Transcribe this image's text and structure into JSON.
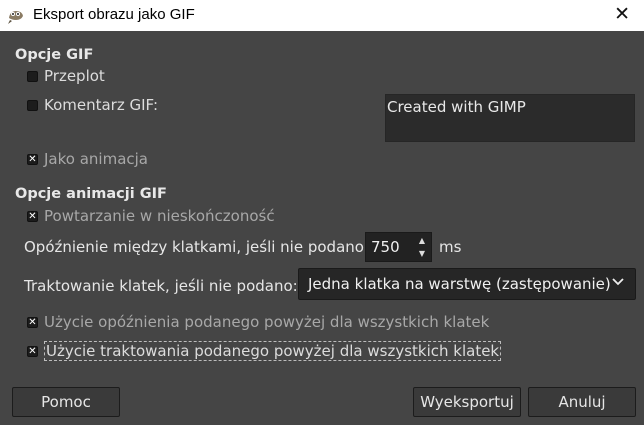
{
  "window": {
    "title": "Eksport obrazu jako GIF",
    "close_glyph": "✕"
  },
  "gif_options": {
    "heading": "Opcje GIF",
    "interlace": {
      "label": "Przeplot",
      "checked": false
    },
    "comment": {
      "label": "Komentarz GIF:",
      "checked": false,
      "value": "Created with GIMP"
    },
    "as_animation": {
      "label": "Jako animacja",
      "checked": true
    }
  },
  "animation_options": {
    "heading": "Opcje animacji GIF",
    "loop_forever": {
      "label": "Powtarzanie w nieskończoność",
      "checked": true
    },
    "delay": {
      "label": "Opóźnienie między klatkami, jeśli nie podano:",
      "value": "750",
      "unit": "ms"
    },
    "disposal": {
      "label": "Traktowanie klatek, jeśli nie podano:",
      "value": "Jedna klatka na warstwę (zastępowanie)"
    },
    "use_delay_all": {
      "label": "Użycie opóźnienia podanego powyżej dla wszystkich klatek",
      "checked": true
    },
    "use_disposal_all": {
      "label": "Użycie traktowania podanego powyżej dla wszystkich klatek",
      "checked": true
    }
  },
  "buttons": {
    "help": "Pomoc",
    "export": "Wyeksportuj",
    "cancel": "Anuluj"
  },
  "icons": {
    "app": "gimp-icon",
    "close": "close-icon",
    "spin_up": "spin-up-icon",
    "spin_down": "spin-down-icon",
    "dropdown": "chevron-down-icon"
  }
}
